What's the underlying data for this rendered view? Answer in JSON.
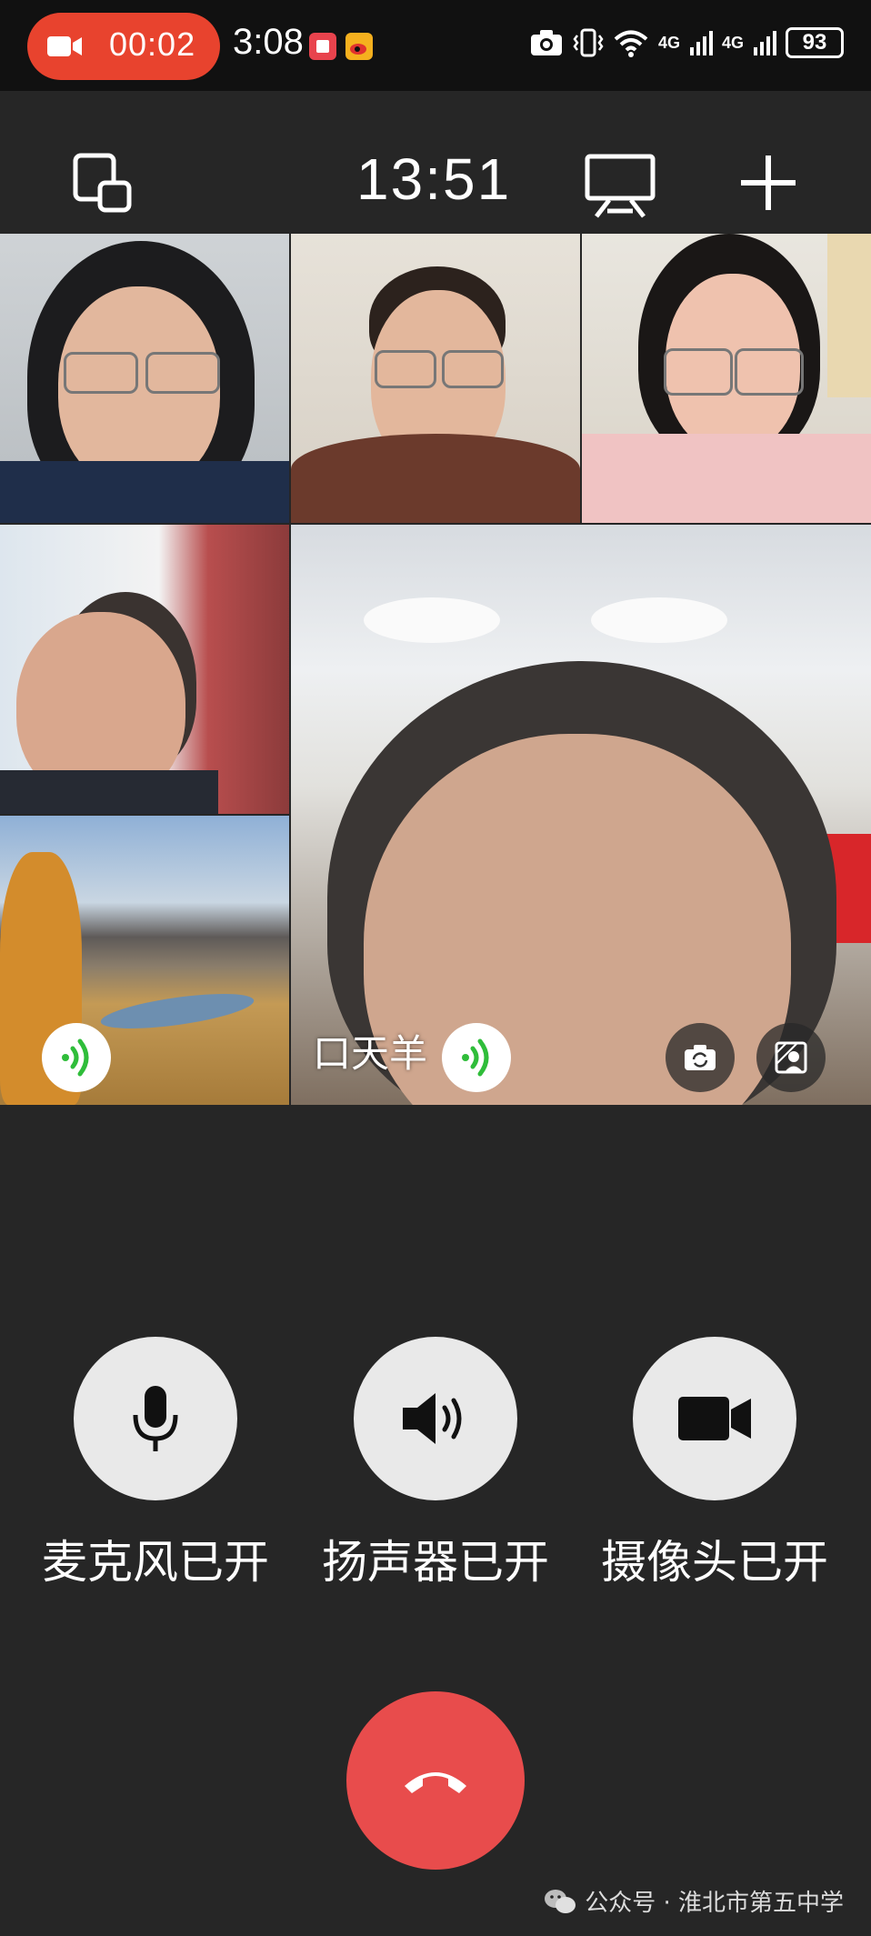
{
  "status_bar": {
    "recording_time": "00:02",
    "clock": "3:08",
    "network_1": "4G",
    "network_2": "4G",
    "battery": "93"
  },
  "toolbar": {
    "call_duration": "13:51"
  },
  "participants": [
    {
      "name": ""
    },
    {
      "name": ""
    },
    {
      "name": ""
    },
    {
      "name": ""
    },
    {
      "name": ""
    },
    {
      "name": "口天羊"
    }
  ],
  "controls": {
    "microphone_label": "麦克风已开",
    "speaker_label": "扬声器已开",
    "camera_label": "摄像头已开"
  },
  "watermark": {
    "text": "公众号 · 淮北市第五中学"
  },
  "colors": {
    "background": "#262626",
    "hangup": "#e84c4c",
    "recording_pill": "#e8432e",
    "speaking_indicator": "#2fbd3a"
  }
}
